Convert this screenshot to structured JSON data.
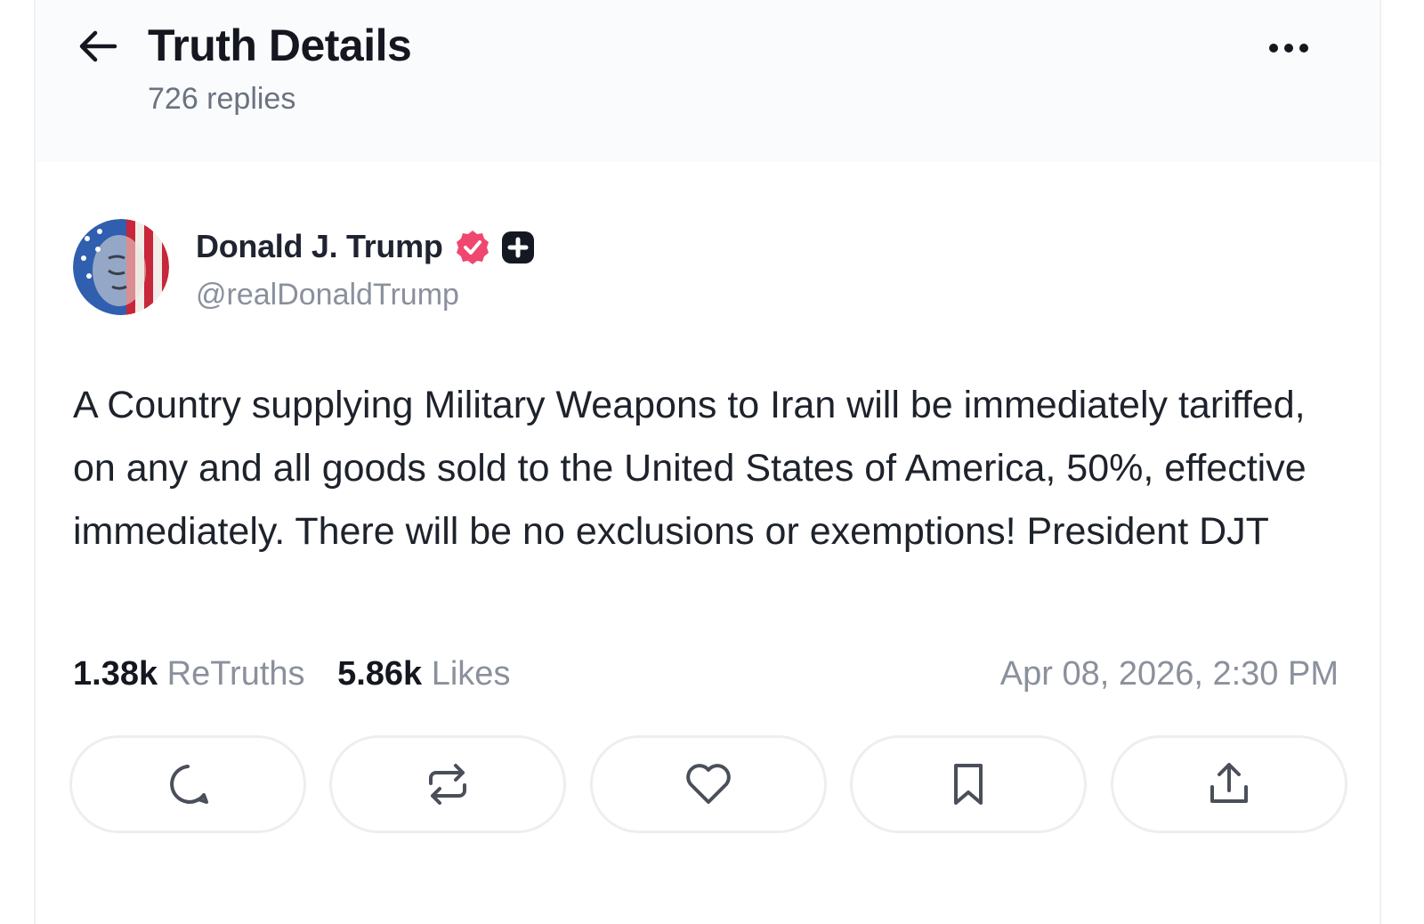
{
  "header": {
    "title": "Truth Details",
    "reply_count": "726 replies"
  },
  "author": {
    "name": "Donald J. Trump",
    "handle": "@realDonaldTrump",
    "verified_color": "#ef4770"
  },
  "post": {
    "text": "A Country supplying Military Weapons to Iran will be immediately tariffed, on any and all goods sold to the United States of America, 50%, effective immediately. There will be no exclusions or exemptions! President DJT"
  },
  "stats": {
    "retruths_count": "1.38k",
    "retruths_label": "ReTruths",
    "likes_count": "5.86k",
    "likes_label": "Likes",
    "timestamp": "Apr 08, 2026, 2:30 PM"
  },
  "actions": [
    "reply-icon",
    "retruth-icon",
    "heart-icon",
    "bookmark-icon",
    "share-icon"
  ],
  "icons": {
    "back": "arrow-left-icon",
    "more": "more-horizontal-icon"
  }
}
